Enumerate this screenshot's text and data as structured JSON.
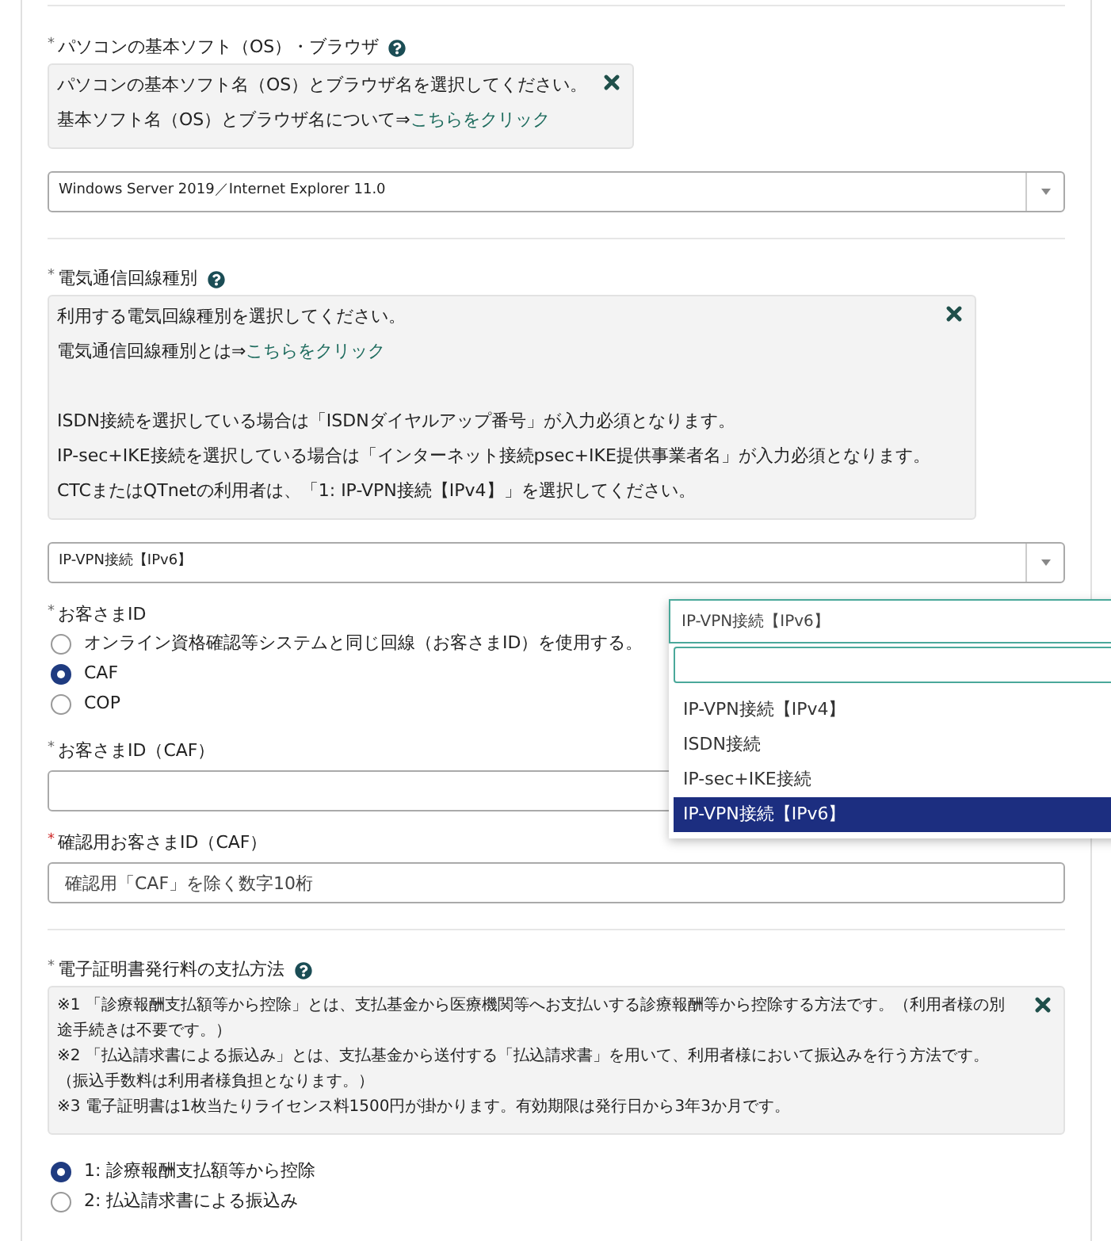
{
  "sections": [
    {
      "kind": "select",
      "label": "パソコンの基本ソフト（OS）・ブラウザ",
      "mark": "*",
      "mark_emphasis": false,
      "help": true,
      "divider_after": true,
      "info": {
        "dense": false,
        "groups": [
          [
            {
              "text": "パソコンの基本ソフト名（OS）とブラウザ名を選択してください。"
            },
            {
              "text": "基本ソフト名（OS）とブラウザ名について⇒",
              "link": "こちらをクリック"
            }
          ]
        ]
      },
      "value": "Windows Server 2019／Internet Explorer 11.0"
    },
    {
      "kind": "select",
      "label": "電気通信回線種別",
      "mark": "*",
      "mark_emphasis": false,
      "help": true,
      "divider_after": false,
      "info": {
        "dense": false,
        "groups": [
          [
            {
              "text": "利用する電気回線種別を選択してください。"
            },
            {
              "text": "電気通信回線種別とは⇒",
              "link": "こちらをクリック"
            }
          ],
          [
            {
              "text": "ISDN接続を選択している場合は「ISDNダイヤルアップ番号」が入力必須となります。"
            },
            {
              "text": "IP-sec+IKE接続を選択している場合は「インターネット接続psec+IKE提供事業者名」が入力必須となります。"
            },
            {
              "text": "CTCまたはQTnetの利用者は、「1: IP-VPN接続【IPv4】」を選択してください。"
            }
          ]
        ]
      },
      "value": "IP-VPN接続【IPv6】"
    },
    {
      "kind": "radio",
      "label": "お客さまID",
      "mark": "*",
      "mark_emphasis": false,
      "help": false,
      "divider_after": false,
      "options": [
        {
          "label": "オンライン資格確認等システムと同じ回線（お客さまID）を使用する。",
          "selected": false
        },
        {
          "label": "CAF",
          "selected": true
        },
        {
          "label": "COP",
          "selected": false
        }
      ]
    },
    {
      "kind": "text",
      "label": "お客さまID（CAF）",
      "mark": "*",
      "mark_emphasis": false,
      "help": false,
      "divider_after": false
    },
    {
      "kind": "text",
      "label": "確認用お客さまID（CAF）",
      "mark": "*",
      "mark_emphasis": true,
      "help": false,
      "divider_after": true,
      "placeholder": "確認用「CAF」を除く数字10桁"
    },
    {
      "kind": "radio",
      "label": "電子証明書発行料の支払方法",
      "mark": "*",
      "mark_emphasis": false,
      "help": true,
      "divider_after": false,
      "info": {
        "dense": true,
        "groups": [
          [
            {
              "text": "※1 「診療報酬支払額等から控除」とは、支払基金から医療機関等へお支払いする診療報酬等から控除する方法です。（利用者様の別途手続きは不要です。）"
            },
            {
              "text": "※2 「払込請求書による振込み」とは、支払基金から送付する「払込請求書」を用いて、利用者様において振込みを行う方法です。（振込手数料は利用者様負担となります。）"
            },
            {
              "text": "※3 電子証明書は1枚当たりライセンス料1500円が掛かります。有効期限は発行日から3年3か月です。"
            }
          ]
        ]
      },
      "options": [
        {
          "label": "1: 診療報酬支払額等から控除",
          "selected": true
        },
        {
          "label": "2: 払込請求書による振込み",
          "selected": false
        }
      ]
    }
  ],
  "dropdown": {
    "value": "IP-VPN接続【IPv6】",
    "options": [
      {
        "label": "IP-VPN接続【IPv4】",
        "selected": false
      },
      {
        "label": "ISDN接続",
        "selected": false
      },
      {
        "label": "IP-sec+IKE接続",
        "selected": false
      },
      {
        "label": "IP-VPN接続【IPv6】",
        "selected": true
      }
    ]
  }
}
